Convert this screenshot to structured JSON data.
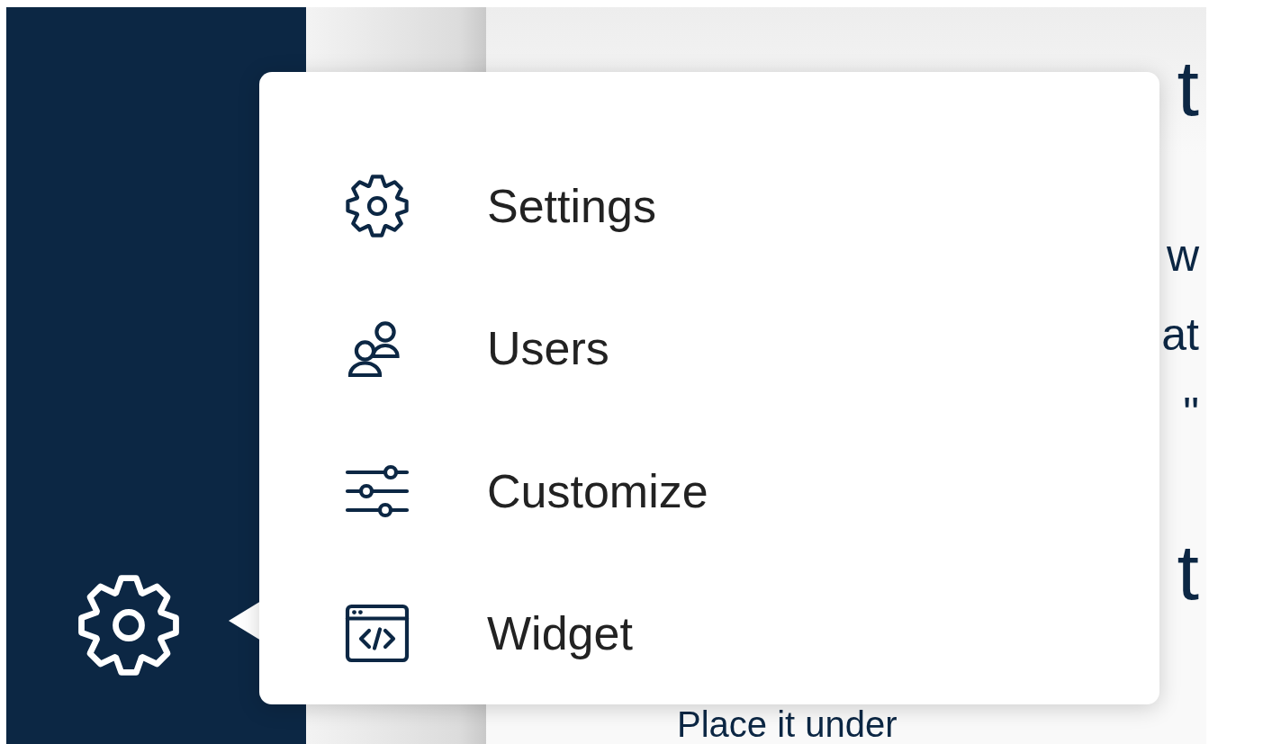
{
  "sidebar": {
    "settings_button": {
      "selected": true
    }
  },
  "content": {
    "lines": [
      {
        "kind": "heading",
        "text": "t"
      },
      {
        "kind": "body",
        "text": "w"
      },
      {
        "kind": "body",
        "text": "at"
      },
      {
        "kind": "body",
        "text": "\""
      },
      {
        "kind": "heading",
        "text": "t"
      },
      {
        "kind": "lead",
        "text": "Place it under"
      }
    ]
  },
  "menu": {
    "items": [
      {
        "kind": "gear",
        "label": "Settings"
      },
      {
        "kind": "users",
        "label": "Users"
      },
      {
        "kind": "sliders",
        "label": "Customize"
      },
      {
        "kind": "code-window",
        "label": "Widget"
      }
    ]
  }
}
